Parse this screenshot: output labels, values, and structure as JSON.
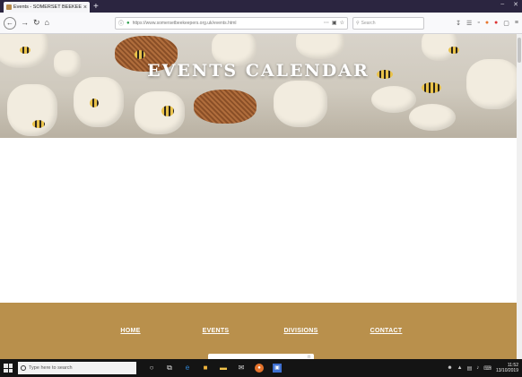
{
  "browser": {
    "tab_title": "Events - SOMERSET BEEKEEPERS",
    "tab_close": "×",
    "new_tab": "+",
    "url": "https://www.somersetbeekeepers.org.uk/events.html",
    "search_placeholder": "Search",
    "window_min": "–",
    "window_close": "✕"
  },
  "hero": {
    "title": "EVENTS CALENDAR"
  },
  "footer": {
    "nav": [
      "HOME",
      "EVENTS",
      "DIVISIONS",
      "CONTACT"
    ]
  },
  "taskbar": {
    "search_placeholder": "Type here to search",
    "time": "11:52",
    "date": "13/10/2019"
  },
  "colors": {
    "footer": "#b9904c",
    "tabbar": "#2b2540",
    "taskbar": "#141414"
  },
  "icons": [
    "back-icon",
    "forward-icon",
    "reload-icon",
    "home-icon",
    "lock-icon",
    "bookmark-star-icon",
    "download-icon",
    "library-icon",
    "menu-icon",
    "windows-start-icon",
    "edge-icon",
    "store-icon",
    "mail-icon",
    "explorer-icon",
    "firefox-icon",
    "photos-icon"
  ]
}
